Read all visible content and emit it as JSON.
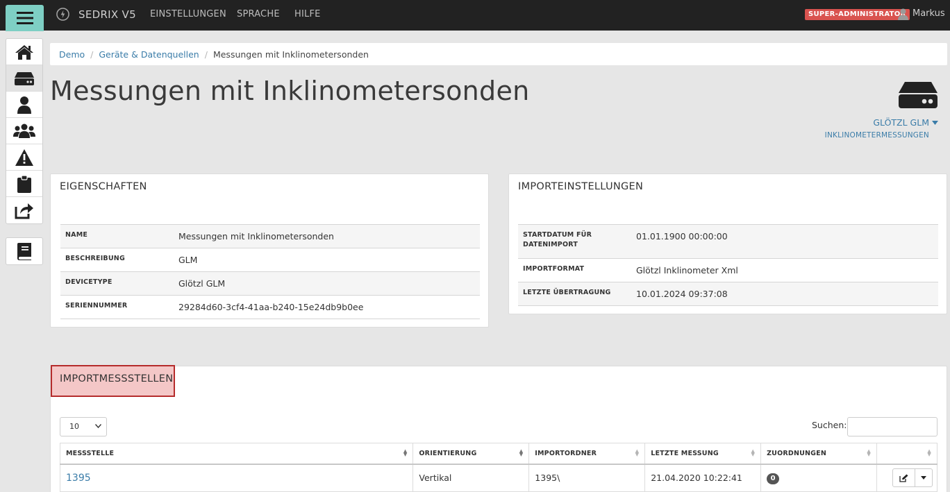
{
  "topbar": {
    "brand": "SEDRIX V5",
    "nav": [
      "EINSTELLUNGEN",
      "SPRACHE",
      "HILFE"
    ],
    "role_badge": "SUPER-ADMINISTRATOR",
    "user_name": "Markus"
  },
  "sidebar": {
    "items": [
      "home-icon",
      "device-icon",
      "user-icon",
      "users-icon",
      "warning-icon",
      "clipboard-icon",
      "share-icon"
    ],
    "docs_item": "book-icon"
  },
  "breadcrumb": {
    "items": [
      "Demo",
      "Geräte & Datenquellen"
    ],
    "current": "Messungen mit Inklinometersonden"
  },
  "page": {
    "title": "Messungen mit Inklinometersonden",
    "device_name": "GLÖTZL GLM",
    "device_sub": "INKLINOMETERMESSUNGEN"
  },
  "properties": {
    "title": "EIGENSCHAFTEN",
    "rows": [
      {
        "key": "NAME",
        "value": "Messungen mit Inklinometersonden"
      },
      {
        "key": "BESCHREIBUNG",
        "value": "GLM"
      },
      {
        "key": "DEVICETYPE",
        "value": "Glötzl GLM"
      },
      {
        "key": "SERIENNUMMER",
        "value": "29284d60-3cf4-41aa-b240-15e24db9b0ee"
      }
    ]
  },
  "import_settings": {
    "title": "IMPORTEINSTELLUNGEN",
    "rows": [
      {
        "key": "STARTDATUM FÜR DATENIMPORT",
        "value": "01.01.1900 00:00:00"
      },
      {
        "key": "IMPORTFORMAT",
        "value": "Glötzl Inklinometer Xml"
      },
      {
        "key": "LETZTE ÜBERTRAGUNG",
        "value": "10.01.2024 09:37:08"
      }
    ]
  },
  "import_points": {
    "title": "IMPORTMESSSTELLEN",
    "page_size": "10",
    "search_label": "Suchen:",
    "search_value": "",
    "columns": [
      "MESSSTELLE",
      "ORIENTIERUNG",
      "IMPORTORDNER",
      "LETZTE MESSUNG",
      "ZUORDNUNGEN",
      ""
    ],
    "rows": [
      {
        "messstelle": "1395",
        "orientierung": "Vertikal",
        "importordner": "1395\\",
        "letzte_messung": "21.04.2020 10:22:41",
        "zuordnungen": "0"
      }
    ]
  },
  "colors": {
    "topbar": "#222222",
    "accent": "#7ecfc4",
    "link": "#3a7ca8",
    "badge": "#d9534f",
    "highlight_border": "#b52b2b"
  }
}
